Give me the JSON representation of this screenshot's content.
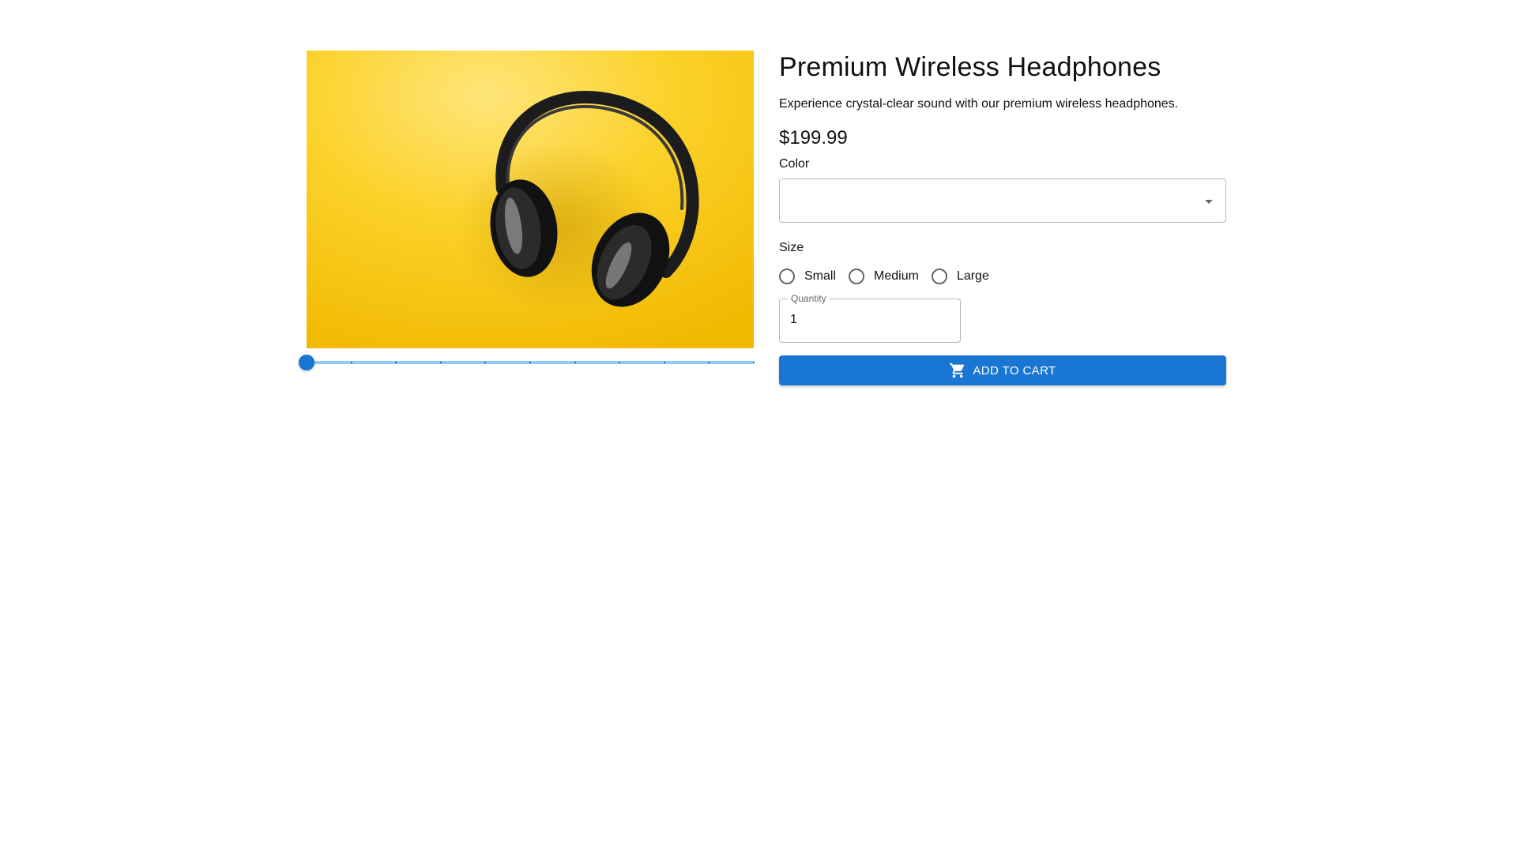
{
  "product": {
    "title": "Premium Wireless Headphones",
    "description": "Experience crystal-clear sound with our premium wireless headphones.",
    "price": "$199.99",
    "image_alt": "headphones-photo"
  },
  "gallery_slider": {
    "min": 0,
    "max": 10,
    "step": 1,
    "value": 0,
    "track_color": "#90caf9",
    "thumb_color": "#1976d2"
  },
  "color_select": {
    "label": "Color",
    "value": ""
  },
  "size": {
    "label": "Size",
    "options": [
      {
        "label": "Small",
        "selected": false
      },
      {
        "label": "Medium",
        "selected": false
      },
      {
        "label": "Large",
        "selected": false
      }
    ]
  },
  "quantity": {
    "label": "Quantity",
    "value": "1"
  },
  "add_to_cart": {
    "label": "ADD TO CART",
    "icon": "cart-icon",
    "color": "#1976d2"
  }
}
